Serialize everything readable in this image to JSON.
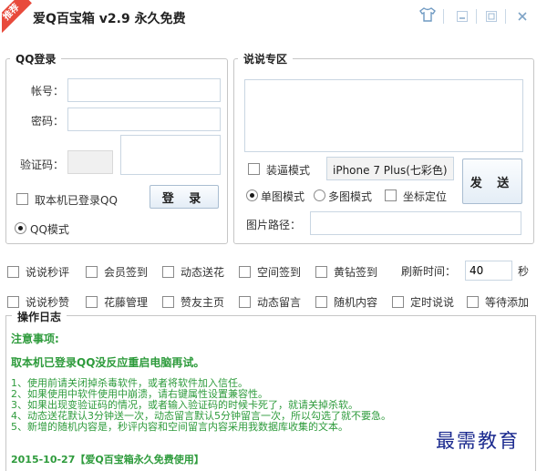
{
  "window": {
    "badge": "推荐",
    "title": "爱Q百宝箱 v2.9  永久免费"
  },
  "login": {
    "legend": "QQ登录",
    "account_label": "帐号：",
    "password_label": "密码：",
    "captcha_label": "验证码：",
    "local_login_label": "取本机已登录QQ",
    "login_button": "登 录",
    "qq_mode_label": "QQ模式"
  },
  "shuoshuo": {
    "legend": "说说专区",
    "fake_mode_label": "装逼模式",
    "device_value": "iPhone 7 Plus(七彩色)",
    "send_button": "发 送",
    "single_image_label": "单图模式",
    "multi_image_label": "多图模式",
    "locate_label": "坐标定位",
    "image_path_label": "图片路径："
  },
  "options": {
    "row1": [
      "说说秒评",
      "会员签到",
      "动态送花",
      "空间签到",
      "黄钻签到"
    ],
    "refresh_label": "刷新时间：",
    "refresh_value": "40",
    "refresh_unit": "秒",
    "row2": [
      "说说秒赞",
      "花藤管理",
      "赞友主页",
      "动态留言",
      "随机内容",
      "定时说说",
      "等待添加"
    ]
  },
  "log": {
    "legend": "操作日志",
    "lines": [
      "注意事项:",
      "",
      "取本机已登录QQ没反应重启电脑再试。",
      "",
      "1、使用前请关闭掉杀毒软件，或者将软件加入信任。",
      "2、如果使用中软件使用中崩溃，请右键属性设置兼容性。",
      "3、如果出现变验证码的情况，或者输入验证码的时候卡死了，就请关掉杀软。",
      "4、动态送花默认3分钟送一次，动态留言默认5分钟留言一次，所以勾选了就不要急。",
      "5、新增的随机内容是，秒评内容和空间留言内容采用我数据库收集的文本。",
      "",
      "",
      "     2015-10-27【爱Q百宝箱永久免费使用】"
    ]
  },
  "watermark": "最需教育"
}
